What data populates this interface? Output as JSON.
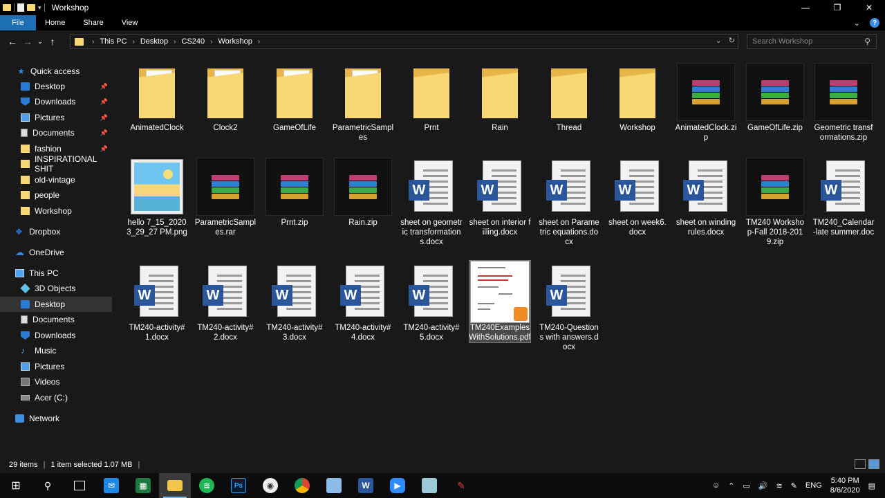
{
  "window": {
    "title": "Workshop",
    "min": "—",
    "restore": "❐",
    "close": "✕"
  },
  "ribbon": {
    "tabs": [
      "File",
      "Home",
      "Share",
      "View"
    ],
    "expand": "⌄",
    "help": "?"
  },
  "address": {
    "crumbs": [
      "This PC",
      "Desktop",
      "CS240",
      "Workshop"
    ],
    "dropdown": "⌄",
    "refresh": "↻"
  },
  "search": {
    "placeholder": "Search Workshop"
  },
  "sidebar": {
    "quick_access": "Quick access",
    "quick_items": [
      "Desktop",
      "Downloads",
      "Pictures",
      "Documents",
      "fashion",
      "INSPIRATIONAL SHIT",
      "old-vintage",
      "people",
      "Workshop"
    ],
    "dropbox": "Dropbox",
    "onedrive": "OneDrive",
    "this_pc": "This PC",
    "pc_items": [
      "3D Objects",
      "Desktop",
      "Documents",
      "Downloads",
      "Music",
      "Pictures",
      "Videos",
      "Acer (C:)"
    ],
    "network": "Network"
  },
  "files": [
    {
      "name": "AnimatedClock",
      "type": "folder"
    },
    {
      "name": "Clock2",
      "type": "folder"
    },
    {
      "name": "GameOfLife",
      "type": "folder"
    },
    {
      "name": "ParametricSamples",
      "type": "folder"
    },
    {
      "name": "Prnt",
      "type": "folder"
    },
    {
      "name": "Rain",
      "type": "folder"
    },
    {
      "name": "Thread",
      "type": "folder"
    },
    {
      "name": "Workshop",
      "type": "folder"
    },
    {
      "name": "AnimatedClock.zip",
      "type": "archive"
    },
    {
      "name": "GameOfLife.zip",
      "type": "archive"
    },
    {
      "name": "Geometric transformations.zip",
      "type": "archive"
    },
    {
      "name": "hello 7_15_2020 3_29_27 PM.png",
      "type": "png"
    },
    {
      "name": "ParametricSamples.rar",
      "type": "archive"
    },
    {
      "name": "Prnt.zip",
      "type": "archive"
    },
    {
      "name": "Rain.zip",
      "type": "archive"
    },
    {
      "name": "sheet on geometric transformations.docx",
      "type": "word"
    },
    {
      "name": "sheet on interior filling.docx",
      "type": "word"
    },
    {
      "name": "sheet on Parametric equations.docx",
      "type": "word"
    },
    {
      "name": "sheet on week6.docx",
      "type": "word"
    },
    {
      "name": "sheet on winding rules.docx",
      "type": "word"
    },
    {
      "name": "TM240 Workshop-Fall 2018-2019.zip",
      "type": "archive"
    },
    {
      "name": "TM240_Calendar-late summer.doc",
      "type": "word"
    },
    {
      "name": "TM240-activity#1.docx",
      "type": "word"
    },
    {
      "name": "TM240-activity#2.docx",
      "type": "word"
    },
    {
      "name": "TM240-activity#3.docx",
      "type": "word"
    },
    {
      "name": "TM240-activity#4.docx",
      "type": "word"
    },
    {
      "name": "TM240-activity#5.docx",
      "type": "word"
    },
    {
      "name": "TM240ExamplesWithSolutions.pdf",
      "type": "pdf"
    },
    {
      "name": "TM240-Questions with answers.docx",
      "type": "word"
    }
  ],
  "status": {
    "count": "29 items",
    "selected": "1 item selected  1.07 MB"
  },
  "taskbar": {
    "lang": "ENG",
    "time": "5:40 PM",
    "date": "8/6/2020"
  }
}
